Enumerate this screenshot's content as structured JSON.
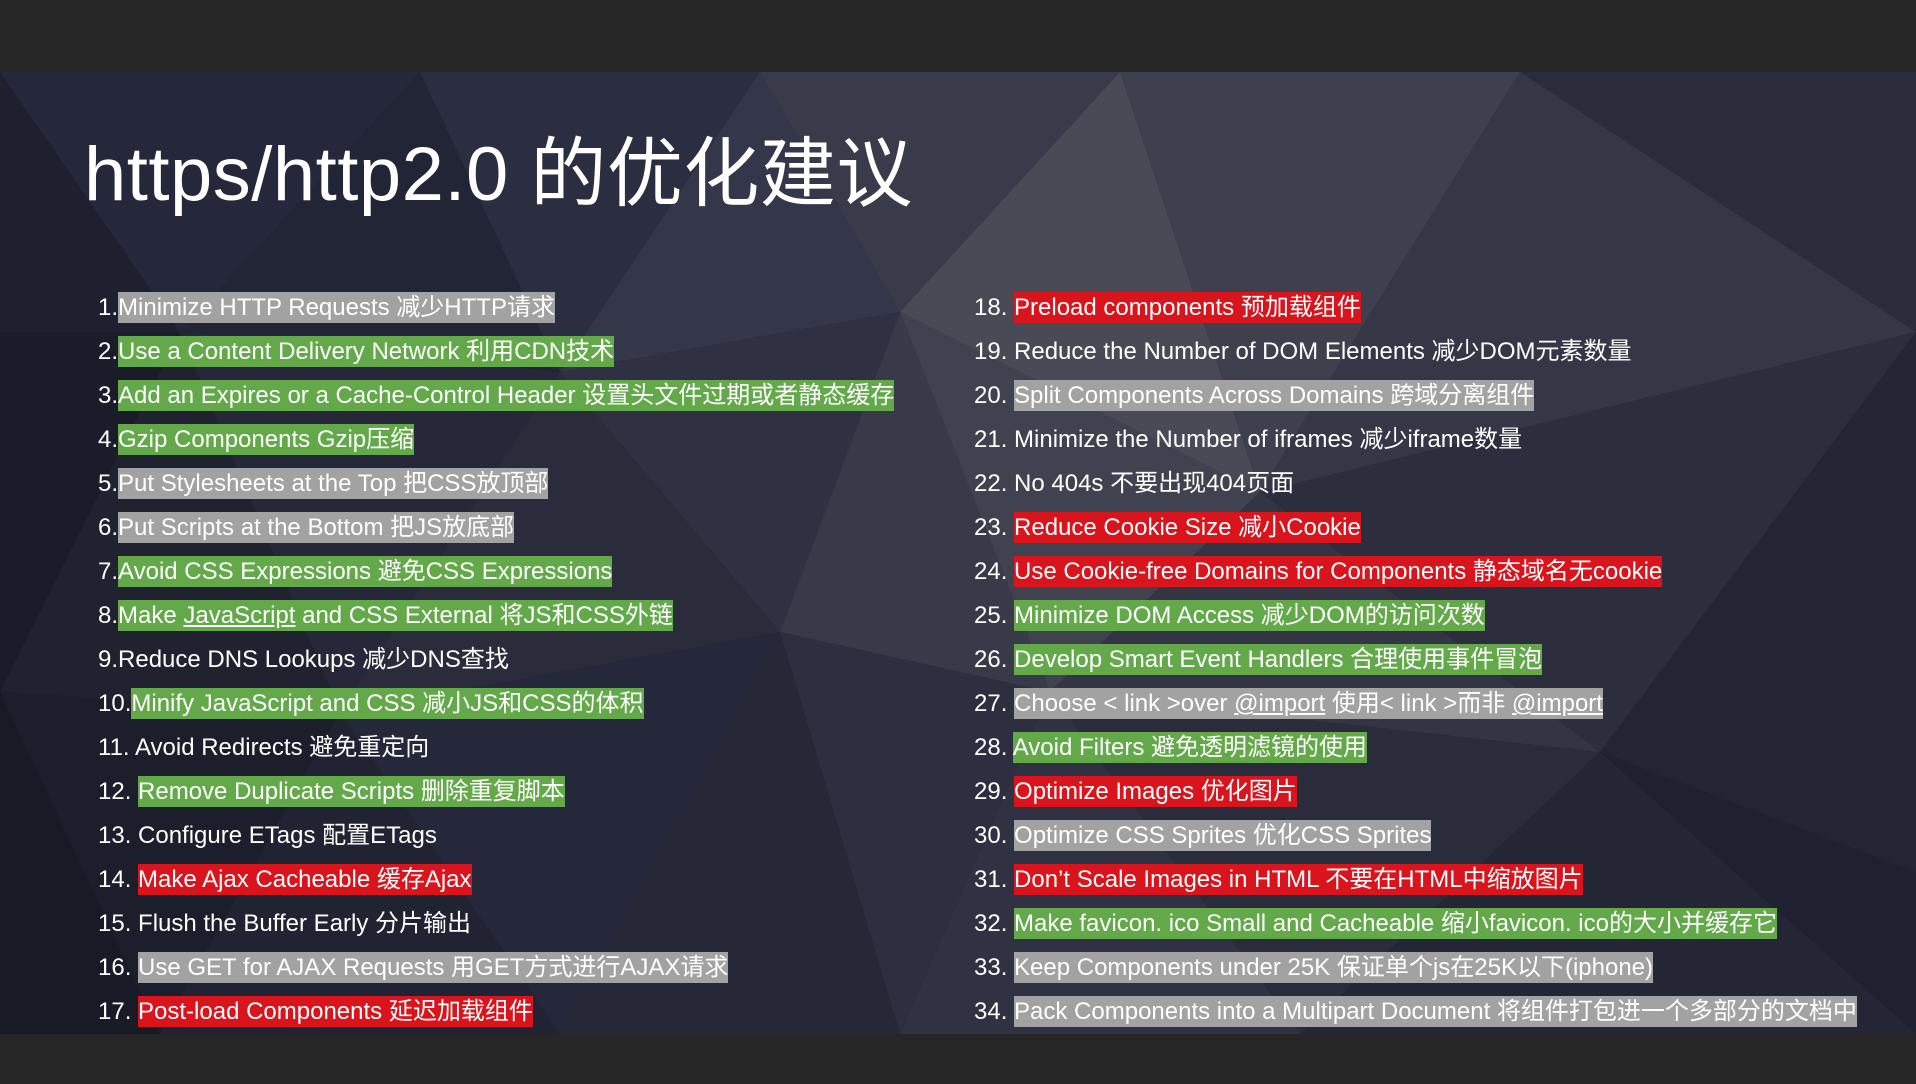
{
  "slide": {
    "title": "https/http2.0 的优化建议"
  },
  "colors": {
    "green": "#63a94a",
    "red": "#d9141c",
    "gray": "#a2a2a2",
    "background": "#1f2131"
  },
  "items": [
    {
      "num": "1.",
      "text": "Minimize HTTP Requests 减少HTTP请求",
      "highlight": "gray"
    },
    {
      "num": "2.",
      "text": "Use a Content Delivery Network 利用CDN技术",
      "highlight": "green"
    },
    {
      "num": "3.",
      "text": "Add an Expires or a Cache-Control Header 设置头文件过期或者静态缓存",
      "highlight": "green"
    },
    {
      "num": "4.",
      "text": "Gzip Components Gzip压缩",
      "highlight": "green"
    },
    {
      "num": "5.",
      "text": "Put Stylesheets at the Top 把CSS放顶部",
      "highlight": "gray"
    },
    {
      "num": "6.",
      "text": "Put Scripts at the Bottom 把JS放底部",
      "highlight": "gray"
    },
    {
      "num": "7.",
      "text": "Avoid CSS Expressions 避免CSS Expressions",
      "highlight": "green"
    },
    {
      "num": "8.",
      "text_before": "Make ",
      "text_link": "JavaScript",
      "text_after": " and CSS External 将JS和CSS外链",
      "highlight": "green"
    },
    {
      "num": "9.",
      "text": "Reduce DNS Lookups 减少DNS查找",
      "highlight": "none"
    },
    {
      "num": "10.",
      "text": "Minify JavaScript and CSS 减小JS和CSS的体积",
      "highlight": "green"
    },
    {
      "num": "11. ",
      "text": "Avoid Redirects 避免重定向",
      "highlight": "none"
    },
    {
      "num": "12. ",
      "text": "Remove Duplicate Scripts 删除重复脚本",
      "highlight": "green"
    },
    {
      "num": "13. ",
      "text": "Configure ETags 配置ETags",
      "highlight": "none"
    },
    {
      "num": "14. ",
      "text": "Make Ajax Cacheable 缓存Ajax",
      "highlight": "red"
    },
    {
      "num": "15. ",
      "text": "Flush the Buffer Early 分片输出",
      "highlight": "none"
    },
    {
      "num": "16. ",
      "text": "Use GET for AJAX Requests 用GET方式进行AJAX请求",
      "highlight": "gray"
    },
    {
      "num": "17. ",
      "text": "Post-load Components 延迟加载组件",
      "highlight": "red"
    },
    {
      "num": "18. ",
      "text": "Preload components 预加载组件",
      "highlight": "red"
    },
    {
      "num": "19. ",
      "text": "Reduce the Number of DOM Elements 减少DOM元素数量",
      "highlight": "none"
    },
    {
      "num": "20. ",
      "text": "Split Components Across Domains 跨域分离组件",
      "highlight": "gray"
    },
    {
      "num": "21. ",
      "text": "Minimize the Number of iframes 减少iframe数量",
      "highlight": "none"
    },
    {
      "num": "22. ",
      "text": "No 404s 不要出现404页面",
      "highlight": "none"
    },
    {
      "num": "23. ",
      "text": "Reduce Cookie Size 减小Cookie",
      "highlight": "red"
    },
    {
      "num": "24. ",
      "text": "Use Cookie-free Domains for Components 静态域名无cookie",
      "highlight": "red"
    },
    {
      "num": "25. ",
      "text": "Minimize DOM Access 减少DOM的访问次数",
      "highlight": "green"
    },
    {
      "num": "26. ",
      "text": "Develop Smart Event Handlers 合理使用事件冒泡",
      "highlight": "green"
    },
    {
      "num": "27. ",
      "text_before": "Choose < link >over ",
      "text_link": "@import",
      "text_after": " 使用< link >而非 ",
      "text_link2": "@import",
      "highlight": "gray"
    },
    {
      "num": "28. ",
      "text": "Avoid Filters 避免透明滤镜的使用",
      "highlight": "green"
    },
    {
      "num": "29. ",
      "text": "Optimize Images 优化图片",
      "highlight": "red"
    },
    {
      "num": "30. ",
      "text": "Optimize CSS Sprites 优化CSS Sprites",
      "highlight": "gray"
    },
    {
      "num": "31. ",
      "text": "Don’t Scale Images in HTML 不要在HTML中缩放图片",
      "highlight": "red"
    },
    {
      "num": "32. ",
      "text": "Make favicon. ico Small and Cacheable 缩小favicon. ico的大小并缓存它",
      "highlight": "green"
    },
    {
      "num": "33. ",
      "text": "Keep Components under 25K 保证单个js在25K以下(iphone)",
      "highlight": "gray"
    },
    {
      "num": "34. ",
      "text": "Pack Components into a Multipart Document 将组件打包进一个多部分的文档中",
      "highlight": "gray"
    }
  ]
}
